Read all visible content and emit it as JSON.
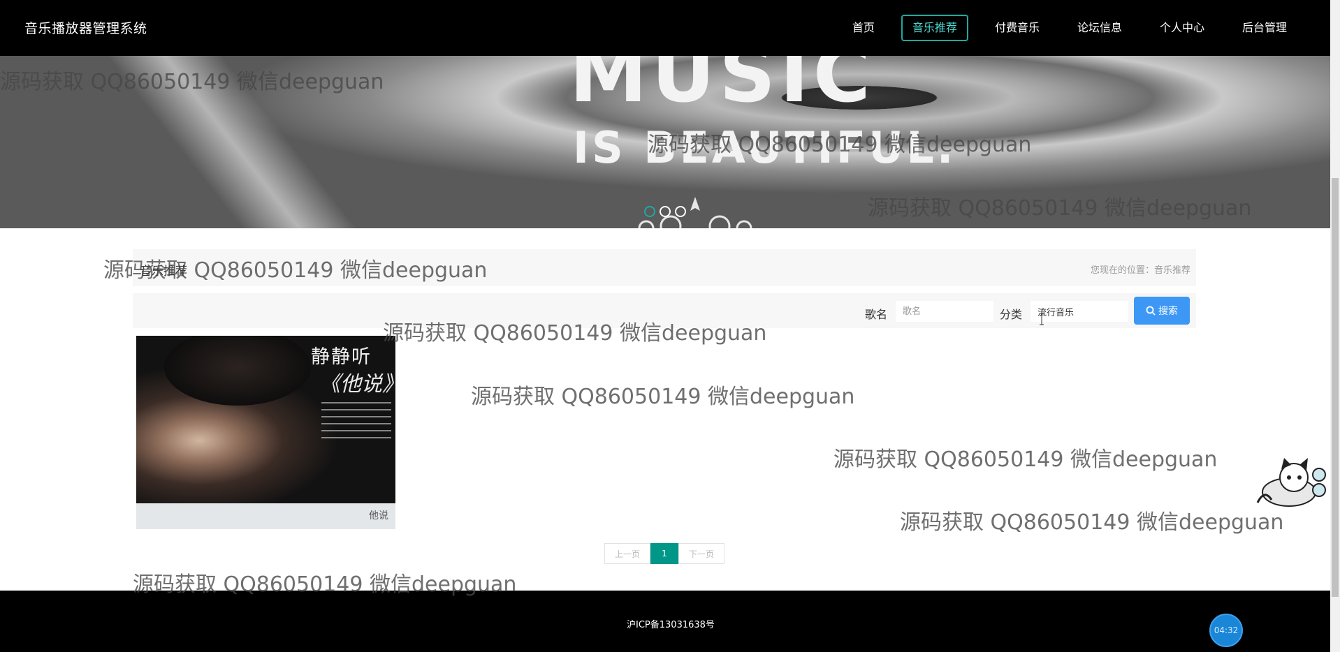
{
  "app": {
    "title": "音乐播放器管理系统"
  },
  "nav": {
    "items": [
      {
        "label": "首页",
        "active": false
      },
      {
        "label": "音乐推荐",
        "active": true
      },
      {
        "label": "付费音乐",
        "active": false
      },
      {
        "label": "论坛信息",
        "active": false
      },
      {
        "label": "个人中心",
        "active": false
      },
      {
        "label": "后台管理",
        "active": false
      }
    ]
  },
  "banner": {
    "headline": "MUSIC",
    "subline": "IS BEAUTIFUL.",
    "dots": 3,
    "active_dot": 1
  },
  "page": {
    "heading": "音乐推荐",
    "location": "您现在的位置：音乐推荐"
  },
  "search": {
    "song_label": "歌名",
    "song_placeholder": "歌名",
    "song_value": "",
    "category_label": "分类",
    "category_value": "流行音乐",
    "button_label": "搜索",
    "button_icon": "search-icon"
  },
  "cards": [
    {
      "caption": "他说",
      "cover_title": "静静听",
      "cover_subtitle": "《他说》"
    }
  ],
  "pagination": {
    "prev": "上一页",
    "current": "1",
    "next": "下一页"
  },
  "footer": {
    "icp": "沪ICP备13031638号",
    "clock": "04:32"
  },
  "watermark": {
    "text": "源码获取 QQ86050149 微信deepguan"
  },
  "colors": {
    "accent": "#1fa8a0",
    "pager_active": "#009688",
    "search_button": "#3d98f5",
    "nav_bg": "#000000"
  }
}
